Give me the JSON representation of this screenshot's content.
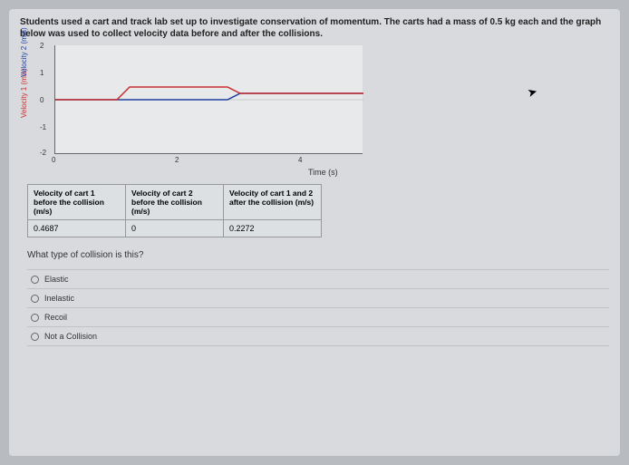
{
  "prompt": "Students used a cart and track lab set up to investigate conservation of momentum. The carts had a mass of 0.5 kg each and the graph below was used to collect velocity data before and after the collisions.",
  "chart_data": {
    "type": "line",
    "xlabel": "Time (s)",
    "ylabel1": "Velocity 1 (m/s)",
    "ylabel2": "Velocity 2 (m/s)",
    "xlim": [
      0,
      5
    ],
    "ylim": [
      -2,
      2
    ],
    "xticks": [
      0,
      2,
      4
    ],
    "yticks": [
      -2,
      -1,
      0,
      1,
      2
    ],
    "series": [
      {
        "name": "Velocity 1",
        "color": "#c83030",
        "x": [
          0,
          1.0,
          1.2,
          2.8,
          3.0,
          5.0
        ],
        "y": [
          0,
          0,
          0.47,
          0.47,
          0.23,
          0.23
        ]
      },
      {
        "name": "Velocity 2",
        "color": "#2040a0",
        "x": [
          0,
          2.8,
          3.0,
          5.0
        ],
        "y": [
          0,
          0,
          0.23,
          0.23
        ]
      }
    ]
  },
  "table": {
    "headers": [
      "Velocity of cart 1 before the collision (m/s)",
      "Velocity of cart 2 before the collision (m/s)",
      "Velocity of cart 1 and 2 after the collision (m/s)"
    ],
    "row": [
      "0.4687",
      "0",
      "0.2272"
    ]
  },
  "question": "What type of collision is this?",
  "options": [
    "Elastic",
    "Inelastic",
    "Recoil",
    "Not a Collision"
  ]
}
